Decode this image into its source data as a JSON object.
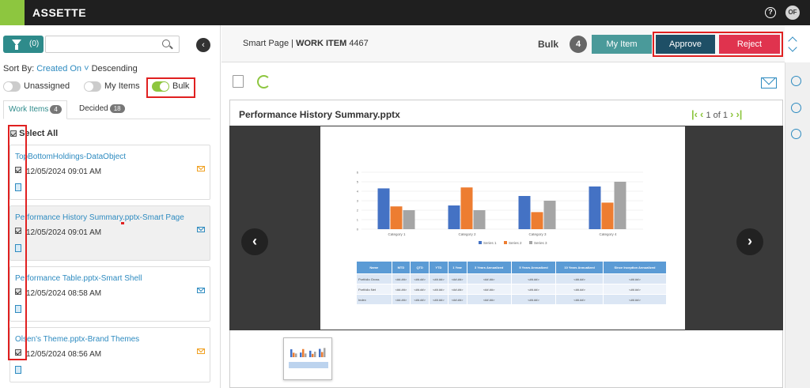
{
  "app": {
    "title": "ASSETTE",
    "help": "?",
    "user_initials": "OF"
  },
  "sidebar": {
    "filter_count": "(0)",
    "search_placeholder": "",
    "sort_prefix": "Sort By:",
    "sort_value": "Created On",
    "sort_dir": "Descending",
    "toggles": [
      {
        "label": "Unassigned",
        "on": false
      },
      {
        "label": "My Items",
        "on": false
      },
      {
        "label": "Bulk",
        "on": true
      }
    ],
    "tabs": [
      {
        "label": "Work Items",
        "count": "4"
      },
      {
        "label": "Decided",
        "count": "18"
      }
    ],
    "select_all": "Select All",
    "items": [
      {
        "title": "TopBottomHoldings-DataObject",
        "date": "12/05/2024 09:01 AM"
      },
      {
        "title": "Performance History Summary.pptx-Smart Page",
        "date": "12/05/2024 09:01 AM"
      },
      {
        "title": "Performance Table.pptx-Smart Shell",
        "date": "12/05/2024 08:58 AM"
      },
      {
        "title": "Olsen's Theme.pptx-Brand Themes",
        "date": "12/05/2024 08:56 AM"
      }
    ]
  },
  "header": {
    "page_type": "Smart Page",
    "sep": "|",
    "work_item_label": "WORK ITEM",
    "work_item_id": "4467",
    "bulk_label": "Bulk",
    "bulk_count": "4",
    "my_item": "My Item",
    "approve": "Approve",
    "reject": "Reject"
  },
  "viewer": {
    "file_name": "Performance History Summary.pptx",
    "pager": "1 of 1",
    "prev": "‹",
    "next": "›"
  },
  "chart_data": {
    "type": "bar",
    "categories": [
      "Category 1",
      "Category 2",
      "Category 3",
      "Category 4"
    ],
    "series": [
      {
        "name": "Series 1",
        "values": [
          4.3,
          2.5,
          3.5,
          4.5
        ],
        "color": "#4472c4"
      },
      {
        "name": "Series 2",
        "values": [
          2.4,
          4.4,
          1.8,
          2.8
        ],
        "color": "#ed7d31"
      },
      {
        "name": "Series 3",
        "values": [
          2,
          2,
          3,
          5
        ],
        "color": "#a5a5a5"
      }
    ],
    "ylim": [
      0,
      6
    ],
    "yticks": [
      "0",
      "1",
      "2",
      "3",
      "4",
      "5",
      "6"
    ]
  },
  "table": {
    "headers": [
      "Name",
      "MTD",
      "QTD",
      "YTD",
      "1 Year",
      "3 Years Annualized",
      "5 Years Annualized",
      "10 Years Annualized",
      "Since Inception Annualized"
    ],
    "rows": [
      [
        "Portfolio Gross",
        "<##.##>",
        "<##.##>",
        "<##.##>",
        "<##.##>",
        "<##.##>",
        "<##.##>",
        "<##.##>",
        "<##.##>"
      ],
      [
        "Portfolio Net",
        "<##.##>",
        "<##.##>",
        "<##.##>",
        "<##.##>",
        "<##.##>",
        "<##.##>",
        "<##.##>",
        "<##.##>"
      ],
      [
        "Index",
        "<##.##>",
        "<##.##>",
        "<##.##>",
        "<##.##>",
        "<##.##>",
        "<##.##>",
        "<##.##>",
        "<##.##>"
      ]
    ]
  }
}
